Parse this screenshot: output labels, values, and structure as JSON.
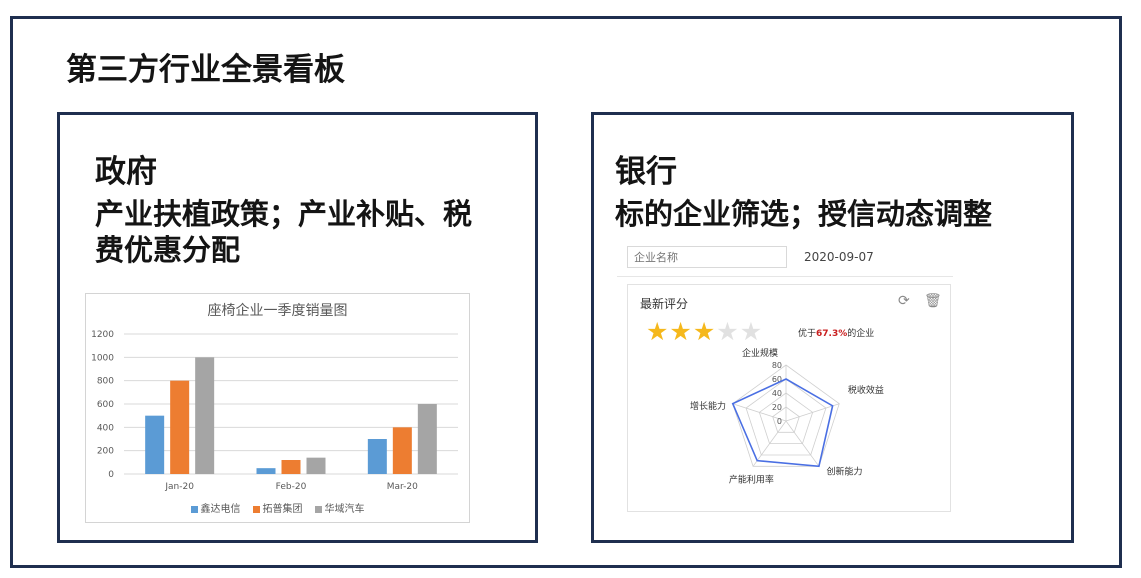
{
  "page": {
    "title": "第三方行业全景看板"
  },
  "government": {
    "heading": "政府",
    "desc_line1": "产业扶植政策；产业补贴、税",
    "desc_line2": "费优惠分配",
    "chart_title": "座椅企业一季度销量图"
  },
  "bank": {
    "heading": "银行",
    "desc": "标的企业筛选；授信动态调整",
    "search_placeholder": "企业名称",
    "date": "2020-09-07",
    "score_title": "最新评分",
    "refresh_icon": "refresh-icon",
    "delete_icon": "trash-icon",
    "rating_stars": 3,
    "rating_max": 5,
    "rank_prefix": "优于",
    "rank_pct": "67.3%",
    "rank_suffix": "的企业"
  },
  "chart_data": [
    {
      "type": "bar",
      "title": "座椅企业一季度销量图",
      "categories": [
        "Jan-20",
        "Feb-20",
        "Mar-20"
      ],
      "series": [
        {
          "name": "鑫达电信",
          "color": "#5b9bd5",
          "values": [
            500,
            50,
            300
          ]
        },
        {
          "name": "拓普集团",
          "color": "#ed7d31",
          "values": [
            800,
            120,
            400
          ]
        },
        {
          "name": "华域汽车",
          "color": "#a5a5a5",
          "values": [
            1000,
            140,
            600
          ]
        }
      ],
      "ylim": [
        0,
        1200
      ],
      "yticks": [
        0,
        200,
        400,
        600,
        800,
        1000,
        1200
      ],
      "legend": "bottom",
      "grid": true
    },
    {
      "type": "radar",
      "axes": [
        "企业规模",
        "税收效益",
        "创新能力",
        "产能利用率",
        "增长能力"
      ],
      "values": [
        60,
        70,
        80,
        70,
        80
      ],
      "rlim": [
        0,
        80
      ],
      "rticks": [
        0,
        20,
        40,
        60,
        80
      ],
      "color": "#4a6fe3"
    }
  ]
}
